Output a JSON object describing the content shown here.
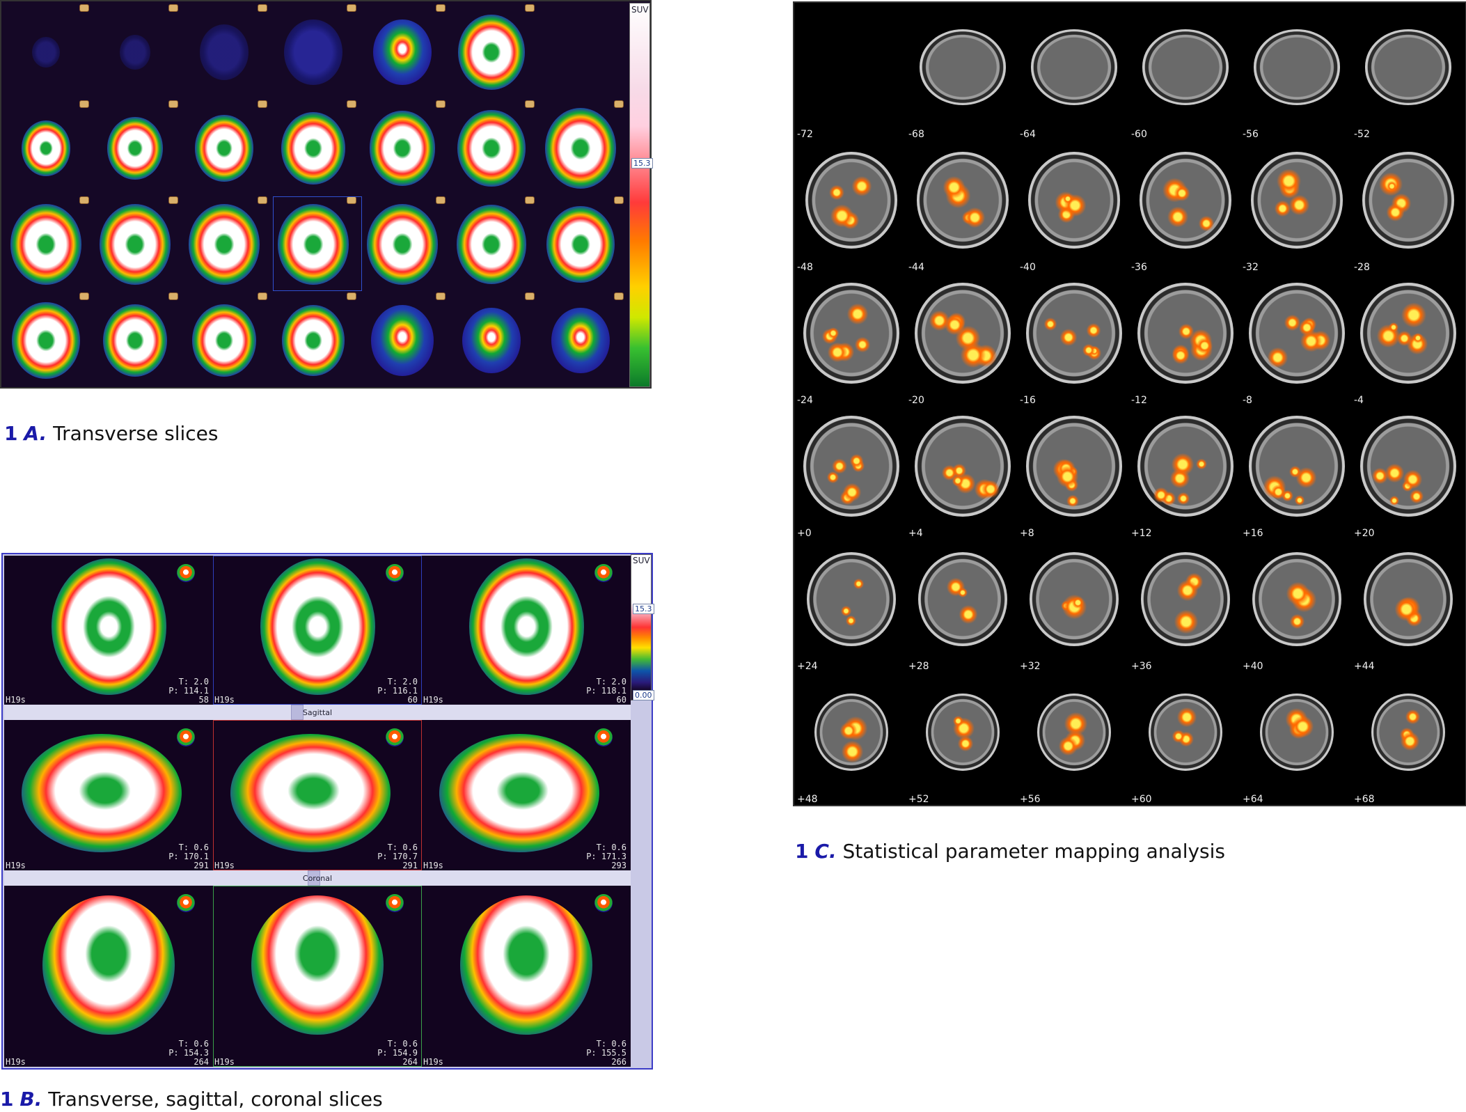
{
  "captions": {
    "a": {
      "num": "1",
      "letter": "A.",
      "text": "Transverse slices"
    },
    "b": {
      "num": "1",
      "letter": "B.",
      "text": "Transverse, sagittal, coronal slices"
    },
    "c": {
      "num": "1",
      "letter": "C.",
      "text": "Statistical parameter mapping analysis"
    }
  },
  "colorbar": {
    "unit": "SUV",
    "max_value": "15.3",
    "min_value": "0.00"
  },
  "panel_b": {
    "divider_sagittal": "Sagittal",
    "divider_coronal": "Coronal",
    "series_label": "H19s",
    "rows": [
      {
        "view": "transverse",
        "panes": [
          {
            "t": "T: 2.0",
            "p": "P: 114.1",
            "idx": "58"
          },
          {
            "t": "T: 2.0",
            "p": "P: 116.1",
            "idx": "60"
          },
          {
            "t": "T: 2.0",
            "p": "P: 118.1",
            "idx": "60"
          }
        ]
      },
      {
        "view": "sagittal",
        "panes": [
          {
            "t": "T: 0.6",
            "p": "P: 170.1",
            "idx": "291"
          },
          {
            "t": "T: 0.6",
            "p": "P: 170.7",
            "idx": "291"
          },
          {
            "t": "T: 0.6",
            "p": "P: 171.3",
            "idx": "293"
          }
        ]
      },
      {
        "view": "coronal",
        "panes": [
          {
            "t": "T: 0.6",
            "p": "P: 154.3",
            "idx": "264"
          },
          {
            "t": "T: 0.6",
            "p": "P: 154.9",
            "idx": "264"
          },
          {
            "t": "T: 0.6",
            "p": "P: 155.5",
            "idx": "266"
          }
        ]
      }
    ]
  },
  "panel_c": {
    "slice_labels": [
      "-72",
      "-68",
      "-64",
      "-60",
      "-56",
      "-52",
      "-48",
      "-44",
      "-40",
      "-36",
      "-32",
      "-28",
      "-24",
      "-20",
      "-16",
      "-12",
      "-8",
      "-4",
      "+0",
      "+4",
      "+8",
      "+12",
      "+16",
      "+20",
      "+24",
      "+28",
      "+32",
      "+36",
      "+40",
      "+44",
      "+48",
      "+52",
      "+56",
      "+60",
      "+64",
      "+68"
    ]
  }
}
